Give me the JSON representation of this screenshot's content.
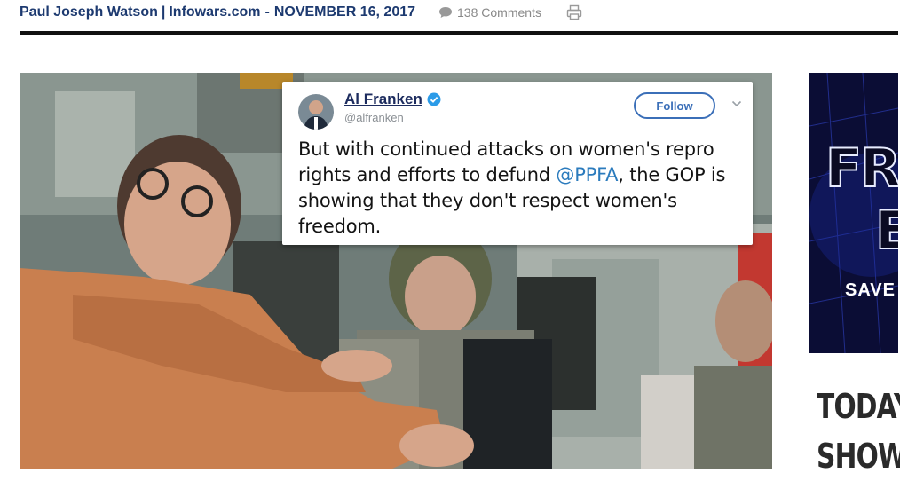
{
  "byline": {
    "author": "Paul Joseph Watson",
    "separator": "|",
    "site": "Infowars.com",
    "dash": "-",
    "date": "NOVEMBER 16, 2017",
    "comments": "138 Comments",
    "comment_icon": "speech-bubble-icon",
    "print_icon": "printer-icon"
  },
  "colors": {
    "byline_text": "#1d3a70",
    "rule": "#111111",
    "tweet_link": "#2b7bbd",
    "follow_border": "#3b6fb8"
  },
  "tweet": {
    "name": "Al Franken",
    "handle": "@alfranken",
    "follow_label": "Follow",
    "text_before": "But with continued attacks on women's repro rights and efforts to defund ",
    "mention": "@PPFA",
    "text_after": ", the GOP is showing that they don't respect women's freedom.",
    "verified_icon": "verified-badge-icon",
    "menu_icon": "chevron-down-icon"
  },
  "ad": {
    "line1": "FRE",
    "line2": "E",
    "save": "SAVE"
  },
  "sidebar": {
    "heading_line1": "TODAY",
    "heading_line2": "SHOW"
  }
}
